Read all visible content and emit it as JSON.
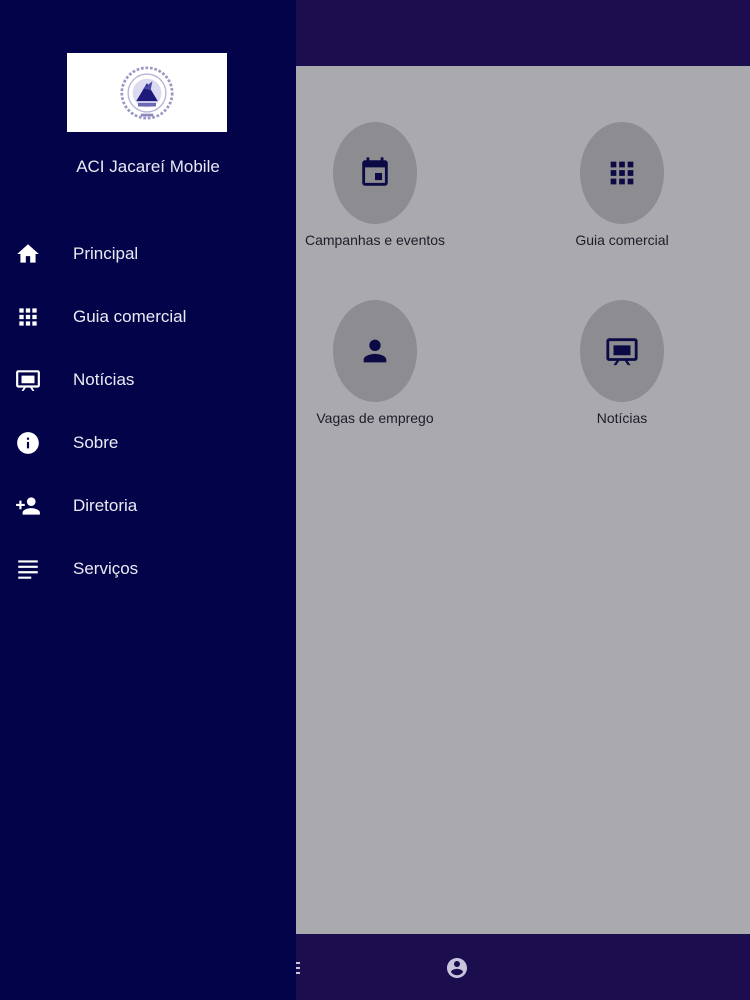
{
  "drawer": {
    "app_name": "ACI Jacareí Mobile",
    "logo_icon": "association-seal-logo",
    "items": [
      {
        "label": "Principal",
        "icon": "home-icon"
      },
      {
        "label": "Guia comercial",
        "icon": "apps-grid-icon"
      },
      {
        "label": "Notícias",
        "icon": "easel-icon"
      },
      {
        "label": "Sobre",
        "icon": "info-icon"
      },
      {
        "label": "Diretoria",
        "icon": "person-add-icon"
      },
      {
        "label": "Serviços",
        "icon": "list-icon"
      }
    ]
  },
  "main": {
    "tiles": [
      {
        "label": "Campanhas e eventos",
        "icon": "calendar-icon"
      },
      {
        "label": "Guia comercial",
        "icon": "apps-grid-icon"
      },
      {
        "label": "Vagas de emprego",
        "icon": "person-icon"
      },
      {
        "label": "Notícias",
        "icon": "easel-icon"
      }
    ]
  },
  "bottom_nav": {
    "icons": [
      "menu-icon",
      "account-circle-icon"
    ]
  },
  "colors": {
    "drawer_bg": "#03034a",
    "bar_bg": "#1c0d4f",
    "content_bg": "#aaa9ad",
    "tile_circle": "#8d8c91",
    "tile_icon": "#0b0a44"
  }
}
